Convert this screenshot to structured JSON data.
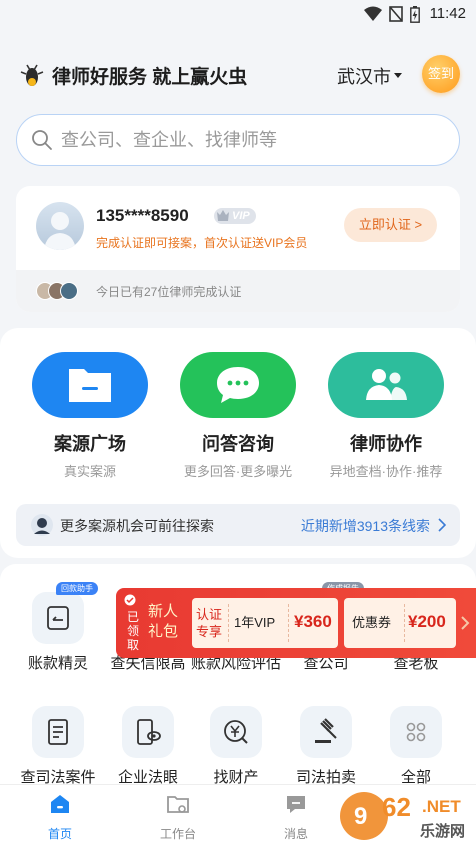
{
  "status": {
    "time": "11:42"
  },
  "header": {
    "slogan": "律师好服务 就上赢火虫",
    "city": "武汉市",
    "signin_label": "签到"
  },
  "search": {
    "placeholder": "查公司、查企业、找律师等"
  },
  "user": {
    "phone": "135****8590",
    "vip_badge": "VIP",
    "tip": "完成认证即可接案，首次认证送VIP会员",
    "verify_button": "立即认证 >",
    "footer_text": "今日已有27位律师完成认证"
  },
  "features": [
    {
      "name": "案源广场",
      "sub": "真实案源",
      "color": "#1e86f2",
      "icon": "folder-icon"
    },
    {
      "name": "问答咨询",
      "sub": "更多回答·更多曝光",
      "color": "#24c25a",
      "icon": "chat-bubble-icon"
    },
    {
      "name": "律师协作",
      "sub": "异地查档·协作·推荐",
      "color": "#2dbd9c",
      "icon": "people-icon"
    }
  ],
  "banner": {
    "text": "更多案源机会可前往探索",
    "link": "近期新增3913条线索"
  },
  "tools": [
    {
      "label": "账款精灵",
      "tag": "回款助手",
      "icon": "debt-icon"
    },
    {
      "label": "查失信限高",
      "icon": "dishonest-icon"
    },
    {
      "label": "账款风险评估",
      "icon": "risk-icon"
    },
    {
      "label": "查公司",
      "tag": "作成报告",
      "icon": "company-icon"
    },
    {
      "label": "查老板",
      "icon": "boss-icon"
    },
    {
      "label": "查司法案件",
      "icon": "case-icon"
    },
    {
      "label": "企业法眼",
      "icon": "law-eye-icon"
    },
    {
      "label": "找财产",
      "icon": "asset-icon"
    },
    {
      "label": "司法拍卖",
      "icon": "auction-icon"
    },
    {
      "label": "全部",
      "icon": "all-icon"
    }
  ],
  "promo": {
    "claimed": "已领取",
    "title": "新人礼包",
    "verify_tag": "认证专享",
    "vip_item": "1年VIP",
    "vip_price": "¥360",
    "coupon_item": "优惠券",
    "coupon_price": "¥200"
  },
  "tabs": [
    {
      "label": "首页",
      "active": true
    },
    {
      "label": "工作台",
      "active": false
    },
    {
      "label": "消息",
      "active": false
    }
  ],
  "watermark": {
    "text": "962.NET",
    "sub": "乐游网"
  },
  "colors": {
    "accent": "#1e86f2",
    "promo_red": "#e83a32",
    "orange": "#e8741f"
  }
}
